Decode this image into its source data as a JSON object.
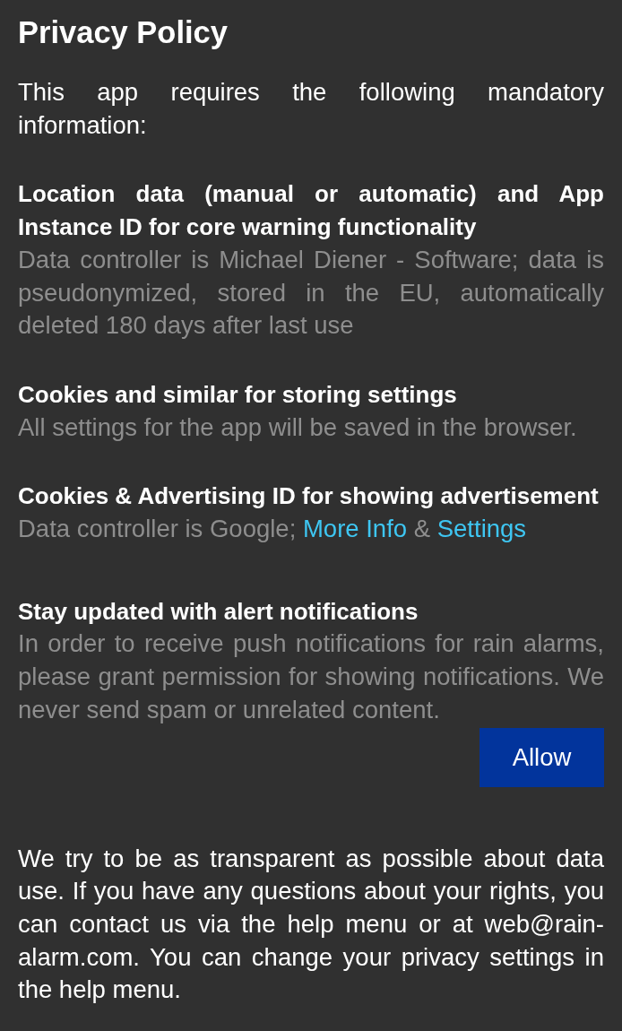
{
  "title": "Privacy Policy",
  "intro": "This app requires the following mandatory information:",
  "sections": [
    {
      "kind": "plain",
      "heading": "Location data (manual or automatic) and App Instance ID for core warning functionality",
      "text": "Data controller is Michael Diener - Software; data is pseudonymized, stored in the EU, automatically deleted 180 days after last use"
    },
    {
      "kind": "plain",
      "heading": "Cookies and similar for storing settings",
      "text": "All settings for the app will be saved in the browser."
    },
    {
      "kind": "linked",
      "heading": "Cookies & Advertising ID for showing advertisement",
      "parts": [
        {
          "kind": "text",
          "text": "Data controller is Google;"
        },
        {
          "kind": "link",
          "text": "More Info"
        },
        {
          "kind": "text",
          "text": "&"
        },
        {
          "kind": "link",
          "text": "Settings"
        }
      ]
    },
    {
      "kind": "action",
      "heading": "Stay updated with alert notifications",
      "text": "In order to receive push notifications for rain alarms, please grant permission for showing notifications. We never send spam or unrelated content.",
      "button": "Allow"
    }
  ],
  "footer": "We try to be as transparent as possible about data use. If you have any questions about your rights, you can contact us via the help menu or at web@rain-alarm.com. You can change your privacy settings in the help menu."
}
